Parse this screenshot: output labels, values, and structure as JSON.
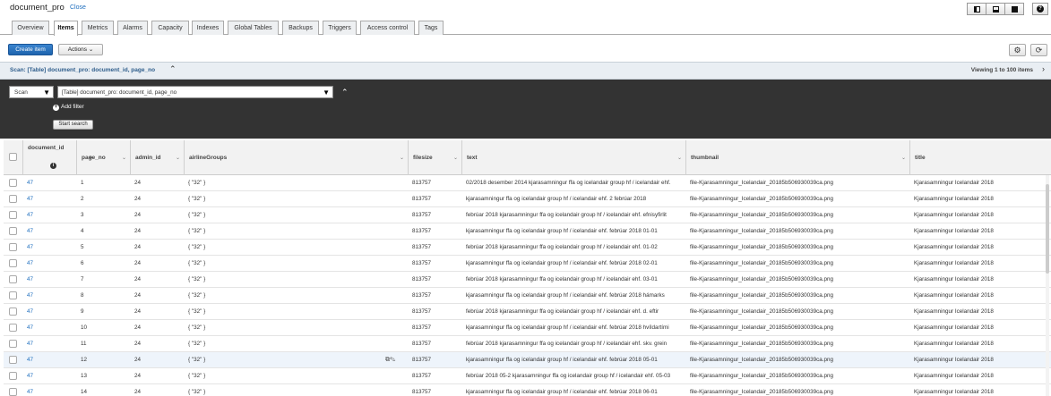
{
  "titlebar": {
    "table_name": "document_pro",
    "close_label": "Close"
  },
  "tabs": [
    {
      "label": "Overview"
    },
    {
      "label": "Items"
    },
    {
      "label": "Metrics"
    },
    {
      "label": "Alarms"
    },
    {
      "label": "Capacity"
    },
    {
      "label": "Indexes"
    },
    {
      "label": "Global Tables"
    },
    {
      "label": "Backups"
    },
    {
      "label": "Triggers"
    },
    {
      "label": "Access control"
    },
    {
      "label": "Tags"
    }
  ],
  "active_tab": "Items",
  "toolbar": {
    "create_label": "Create item",
    "actions_label": "Actions ⌄"
  },
  "scan_header": {
    "label": "Scan: [Table] document_pro: document_id, page_no",
    "viewing": "Viewing 1 to 100 items"
  },
  "scan_panel": {
    "mode": "Scan",
    "target": "[Table] document_pro: document_id, page_no",
    "add_filter": "Add filter",
    "start_search": "Start search"
  },
  "columns": [
    {
      "label": "document_id"
    },
    {
      "label": "page_no"
    },
    {
      "label": "admin_id"
    },
    {
      "label": "airlineGroups"
    },
    {
      "label": "filesize"
    },
    {
      "label": "text"
    },
    {
      "label": "thumbnail"
    },
    {
      "label": "title"
    }
  ],
  "rows": [
    {
      "document_id": "47",
      "page_no": "1",
      "admin_id": "24",
      "airlineGroups": "{ \"32\" }",
      "filesize": "813757",
      "text": "02/2018 desember 2014 kjarasamningur ffa og icelandair group hf / icelandair ehf.",
      "thumbnail": "file-Kjarasamningur_Icelandair_20185b506930039ca.png",
      "title": "Kjarasamningur Icelandair 2018"
    },
    {
      "document_id": "47",
      "page_no": "2",
      "admin_id": "24",
      "airlineGroups": "{ \"32\" }",
      "filesize": "813757",
      "text": "kjarasamningur ffa og icelandair group hf / icelandair ehf. 2 febrúar 2018",
      "thumbnail": "file-Kjarasamningur_Icelandair_20185b506930039ca.png",
      "title": "Kjarasamningur Icelandair 2018"
    },
    {
      "document_id": "47",
      "page_no": "3",
      "admin_id": "24",
      "airlineGroups": "{ \"32\" }",
      "filesize": "813757",
      "text": "febrúar 2018 kjarasamningur ffa og icelandair group hf / icelandair ehf. efnisyfirlit",
      "thumbnail": "file-Kjarasamningur_Icelandair_20185b506930039ca.png",
      "title": "Kjarasamningur Icelandair 2018"
    },
    {
      "document_id": "47",
      "page_no": "4",
      "admin_id": "24",
      "airlineGroups": "{ \"32\" }",
      "filesize": "813757",
      "text": "kjarasamningur ffa og icelandair group hf / icelandair ehf. febrúar 2018 01-01",
      "thumbnail": "file-Kjarasamningur_Icelandair_20185b506930039ca.png",
      "title": "Kjarasamningur Icelandair 2018"
    },
    {
      "document_id": "47",
      "page_no": "5",
      "admin_id": "24",
      "airlineGroups": "{ \"32\" }",
      "filesize": "813757",
      "text": "febrúar 2018 kjarasamningur ffa og icelandair group hf / icelandair ehf. 01-02",
      "thumbnail": "file-Kjarasamningur_Icelandair_20185b506930039ca.png",
      "title": "Kjarasamningur Icelandair 2018"
    },
    {
      "document_id": "47",
      "page_no": "6",
      "admin_id": "24",
      "airlineGroups": "{ \"32\" }",
      "filesize": "813757",
      "text": "kjarasamningur ffa og icelandair group hf / icelandair ehf. febrúar 2018 02-01",
      "thumbnail": "file-Kjarasamningur_Icelandair_20185b506930039ca.png",
      "title": "Kjarasamningur Icelandair 2018"
    },
    {
      "document_id": "47",
      "page_no": "7",
      "admin_id": "24",
      "airlineGroups": "{ \"32\" }",
      "filesize": "813757",
      "text": "febrúar 2018 kjarasamningur ffa og icelandair group hf / icelandair ehf. 03-01",
      "thumbnail": "file-Kjarasamningur_Icelandair_20185b506930039ca.png",
      "title": "Kjarasamningur Icelandair 2018"
    },
    {
      "document_id": "47",
      "page_no": "8",
      "admin_id": "24",
      "airlineGroups": "{ \"32\" }",
      "filesize": "813757",
      "text": "kjarasamningur ffa og icelandair group hf / icelandair ehf. febrúar 2018 hámarks",
      "thumbnail": "file-Kjarasamningur_Icelandair_20185b506930039ca.png",
      "title": "Kjarasamningur Icelandair 2018"
    },
    {
      "document_id": "47",
      "page_no": "9",
      "admin_id": "24",
      "airlineGroups": "{ \"32\" }",
      "filesize": "813757",
      "text": "febrúar 2018 kjarasamningur ffa og icelandair group hf / icelandair ehf. d. eftir",
      "thumbnail": "file-Kjarasamningur_Icelandair_20185b506930039ca.png",
      "title": "Kjarasamningur Icelandair 2018"
    },
    {
      "document_id": "47",
      "page_no": "10",
      "admin_id": "24",
      "airlineGroups": "{ \"32\" }",
      "filesize": "813757",
      "text": "kjarasamningur ffa og icelandair group hf / icelandair ehf. febrúar 2018 hvíldartími",
      "thumbnail": "file-Kjarasamningur_Icelandair_20185b506930039ca.png",
      "title": "Kjarasamningur Icelandair 2018"
    },
    {
      "document_id": "47",
      "page_no": "11",
      "admin_id": "24",
      "airlineGroups": "{ \"32\" }",
      "filesize": "813757",
      "text": "febrúar 2018 kjarasamningur ffa og icelandair group hf / icelandair ehf. skv. grein",
      "thumbnail": "file-Kjarasamningur_Icelandair_20185b506930039ca.png",
      "title": "Kjarasamningur Icelandair 2018"
    },
    {
      "document_id": "47",
      "page_no": "12",
      "admin_id": "24",
      "airlineGroups": "{ \"32\" }",
      "filesize": "813757",
      "text": "kjarasamningur ffa og icelandair group hf / icelandair ehf. febrúar 2018 05-01",
      "thumbnail": "file-Kjarasamningur_Icelandair_20185b506930039ca.png",
      "title": "Kjarasamningur Icelandair 2018"
    },
    {
      "document_id": "47",
      "page_no": "13",
      "admin_id": "24",
      "airlineGroups": "{ \"32\" }",
      "filesize": "813757",
      "text": "febrúar 2018 05-2 kjarasamningur ffa og icelandair group hf / icelandair ehf. 05-03",
      "thumbnail": "file-Kjarasamningur_Icelandair_20185b506930039ca.png",
      "title": "Kjarasamningur Icelandair 2018"
    },
    {
      "document_id": "47",
      "page_no": "14",
      "admin_id": "24",
      "airlineGroups": "{ \"32\" }",
      "filesize": "813757",
      "text": "kjarasamningur ffa og icelandair group hf / icelandair ehf. febrúar 2018 06-01",
      "thumbnail": "file-Kjarasamningur_Icelandair_20185b506930039ca.png",
      "title": "Kjarasamningur Icelandair 2018"
    }
  ],
  "highlighted_row": 12
}
